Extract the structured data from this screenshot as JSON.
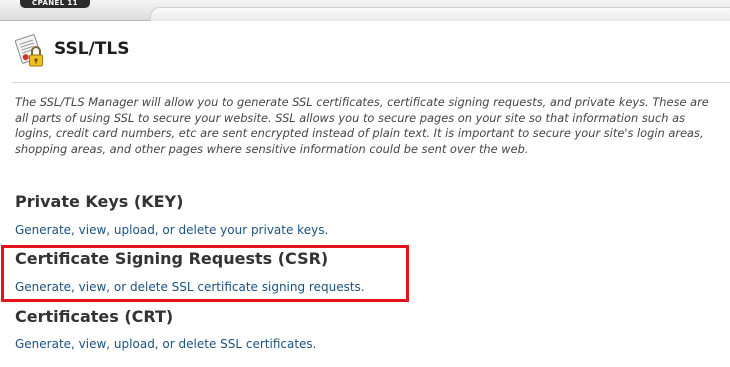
{
  "brand": {
    "name": "CPANEL 11"
  },
  "page": {
    "title": "SSL/TLS",
    "icon": "ssl-certificate-lock-icon",
    "intro": "The SSL/TLS Manager will allow you to generate SSL certificates, certificate signing requests, and private keys. These are all parts of using SSL to secure your website. SSL allows you to secure pages on your site so that information such as logins, credit card numbers, etc are sent encrypted instead of plain text. It is important to secure your site's login areas, shopping areas, and other pages where sensitive information could be sent over the web."
  },
  "sections": [
    {
      "heading": "Private Keys (KEY)",
      "link": "Generate, view, upload, or delete your private keys."
    },
    {
      "heading": "Certificate Signing Requests (CSR)",
      "link": "Generate, view, or delete SSL certificate signing requests.",
      "highlighted": true
    },
    {
      "heading": "Certificates (CRT)",
      "link": "Generate, view, upload, or delete SSL certificates."
    }
  ],
  "colors": {
    "link": "#1c5280",
    "heading": "#333333",
    "highlight": "#e3141b"
  }
}
